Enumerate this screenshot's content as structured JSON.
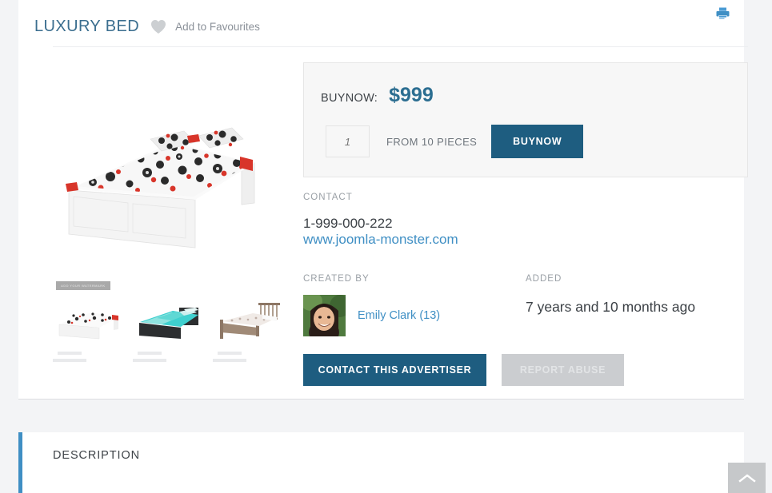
{
  "listing": {
    "title": "LUXURY BED",
    "favourites_label": "Add to Favourites",
    "heart_icon": "heart-icon",
    "print_icon": "printer-icon"
  },
  "gallery": {
    "watermark_text": "ADD YOUR WATERMARK",
    "thumbnails": [
      {
        "name": "thumbnail-white-bed"
      },
      {
        "name": "thumbnail-dark-bed"
      },
      {
        "name": "thumbnail-wooden-bed"
      }
    ]
  },
  "price_box": {
    "label": "BUYNOW:",
    "value": "$999",
    "quantity_placeholder": "1",
    "quantity_value": "",
    "pieces_label": "FROM 10 PIECES",
    "buy_button": "BUYNOW"
  },
  "contact": {
    "heading": "CONTACT",
    "phone": "1-999-000-222",
    "website": "www.joomla-monster.com"
  },
  "created_by": {
    "heading": "CREATED BY",
    "author_name": "Emily Clark (13)",
    "avatar": "user-avatar"
  },
  "added": {
    "heading": "ADDED",
    "value": "7 years and 10 months ago"
  },
  "actions": {
    "contact_advertiser": "CONTACT THIS ADVERTISER",
    "report_abuse": "REPORT ABUSE"
  },
  "description_panel": {
    "title": "DESCRIPTION"
  },
  "scroll_top": {
    "icon": "chevron-up-icon"
  },
  "colors": {
    "accent_blue": "#1e5d80",
    "link_blue": "#3f8fc4",
    "title_blue": "#3b6e8f",
    "page_bg": "#f3f4f6",
    "card_bg": "#ffffff",
    "panel_bg": "#f7f7f7",
    "disabled_gray": "#cbcdd0"
  }
}
